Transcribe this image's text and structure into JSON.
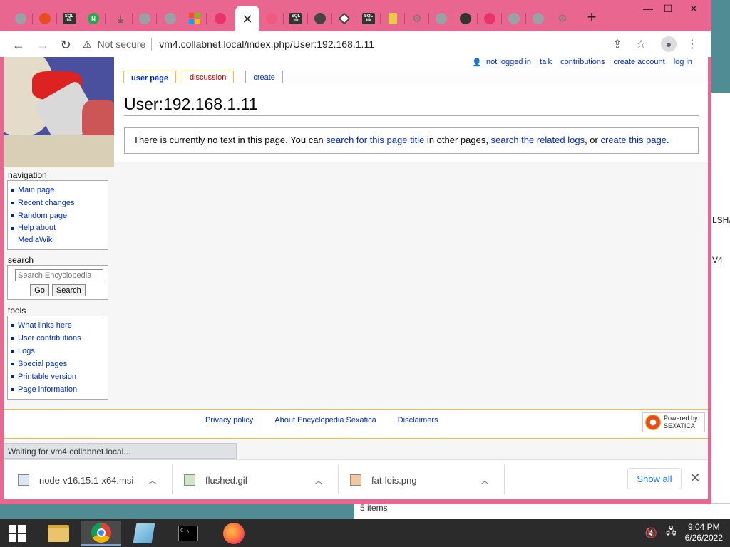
{
  "browser": {
    "tabs": [
      {
        "icon": "globe-icon",
        "color": "#999"
      },
      {
        "icon": "red-logo-icon",
        "color": "#e84c20"
      },
      {
        "icon": "sqlite-icon",
        "label": "SQL ite",
        "color": "#333"
      },
      {
        "icon": "n-icon",
        "label": "N",
        "color": "#2da44e"
      },
      {
        "icon": "download-icon",
        "color": "#999"
      },
      {
        "icon": "globe-icon",
        "color": "#999"
      },
      {
        "icon": "globe-icon",
        "color": "#999"
      },
      {
        "icon": "microsoft-icon",
        "color": "#f35325"
      },
      {
        "icon": "firefox-icon",
        "color": "#e8336d"
      }
    ],
    "tabs_right": [
      {
        "icon": "flower-icon",
        "color": "#f05a7e"
      },
      {
        "icon": "sqlite-icon",
        "label": "SQL ite",
        "color": "#333"
      },
      {
        "icon": "circle-icon",
        "color": "#444"
      },
      {
        "icon": "diamond-icon",
        "color": "#444"
      },
      {
        "icon": "sqlite-icon",
        "label": "SQL ite",
        "color": "#333"
      },
      {
        "icon": "folder-icon",
        "color": "#e8c94a"
      },
      {
        "icon": "gear-icon",
        "color": "#999"
      },
      {
        "icon": "globe-icon",
        "color": "#999"
      },
      {
        "icon": "shield-icon",
        "color": "#333"
      },
      {
        "icon": "firefox-icon",
        "color": "#e8336d"
      },
      {
        "icon": "globe-icon",
        "color": "#999"
      },
      {
        "icon": "globe-icon",
        "color": "#999"
      },
      {
        "icon": "gear-icon",
        "color": "#999"
      }
    ],
    "active_tab_close": "✕",
    "new_tab": "+",
    "security_label": "Not secure",
    "url": "vm4.collabnet.local/index.php/User:192.168.1.11",
    "status_text": "Waiting for vm4.collabnet.local..."
  },
  "wiki": {
    "personal": [
      "not logged in",
      "talk",
      "contributions",
      "create account",
      "log in"
    ],
    "tabs": {
      "user_page": "user page",
      "discussion": "discussion",
      "create": "create"
    },
    "title": "User:192.168.1.11",
    "notext": {
      "before": "There is currently no text in this page. You can ",
      "link1": "search for this page title",
      "mid1": " in other pages, ",
      "link2": "search the related logs",
      "mid2": ", or ",
      "link3": "create this page",
      "end": "."
    },
    "navigation": {
      "title": "navigation",
      "items": [
        "Main page",
        "Recent changes",
        "Random page",
        "Help about",
        "MediaWiki"
      ]
    },
    "search": {
      "title": "search",
      "placeholder": "Search Encyclopedia",
      "go": "Go",
      "search": "Search"
    },
    "tools": {
      "title": "tools",
      "items": [
        "What links here",
        "User contributions",
        "Logs",
        "Special pages",
        "Printable version",
        "Page information"
      ]
    },
    "footer": {
      "links": [
        "Privacy policy",
        "About Encyclopedia Sexatica",
        "Disclaimers"
      ],
      "powered_line1": "Powered by",
      "powered_line2": "SEXATICA"
    }
  },
  "downloads": {
    "items": [
      "node-v16.15.1-x64.msi",
      "flushed.gif",
      "fat-lois.png"
    ],
    "show_all": "Show all",
    "close": "✕"
  },
  "background": {
    "fragments": [
      "LSHA",
      "V4"
    ],
    "bottom": "5 items"
  },
  "taskbar": {
    "time": "9:04 PM",
    "date": "6/26/2022"
  }
}
